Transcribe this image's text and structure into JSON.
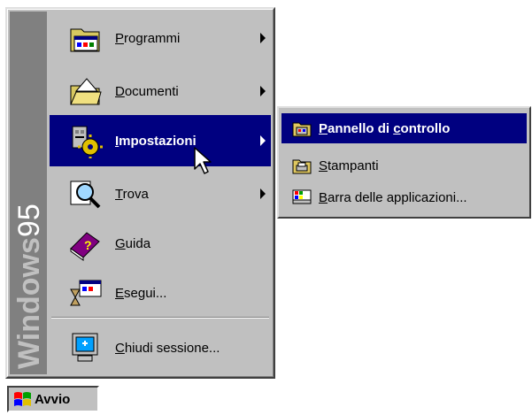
{
  "start_menu": {
    "banner": {
      "bold": "Windows",
      "light": "95"
    },
    "items": [
      {
        "name": "programmi",
        "underline": "P",
        "rest": "rogrammi",
        "icon": "programs-folder-icon",
        "has_submenu": true
      },
      {
        "name": "documenti",
        "underline": "D",
        "rest": "ocumenti",
        "icon": "documents-folder-icon",
        "has_submenu": true
      },
      {
        "name": "impostazioni",
        "underline": "I",
        "rest": "mpostazioni",
        "icon": "settings-icon",
        "has_submenu": true
      },
      {
        "name": "trova",
        "underline": "T",
        "rest": "rova",
        "icon": "find-magnifier-icon",
        "has_submenu": true
      },
      {
        "name": "guida",
        "underline": "G",
        "rest": "uida",
        "icon": "help-book-icon",
        "has_submenu": false
      },
      {
        "name": "esegui",
        "underline": "E",
        "rest": "segui...",
        "icon": "run-icon",
        "has_submenu": false
      },
      {
        "name": "chiudi-sessione",
        "underline": "C",
        "rest": "hiudi sessione...",
        "icon": "shutdown-monitor-icon",
        "has_submenu": false
      }
    ]
  },
  "submenu": {
    "items": [
      {
        "pre": "",
        "underline": "P",
        "mid": "annello di ",
        "underline2": "c",
        "post": "ontrollo",
        "icon": "control-panel-icon"
      },
      {
        "pre": "",
        "underline": "S",
        "mid": "tampanti",
        "underline2": "",
        "post": "",
        "icon": "printers-icon"
      },
      {
        "pre": "",
        "underline": "B",
        "mid": "arra delle applicazioni...",
        "underline2": "",
        "post": "",
        "icon": "taskbar-icon"
      }
    ]
  },
  "start_button": {
    "label": "Avvio"
  },
  "colors": {
    "highlight": "#000080",
    "face": "#c0c0c0",
    "banner": "#808080"
  }
}
